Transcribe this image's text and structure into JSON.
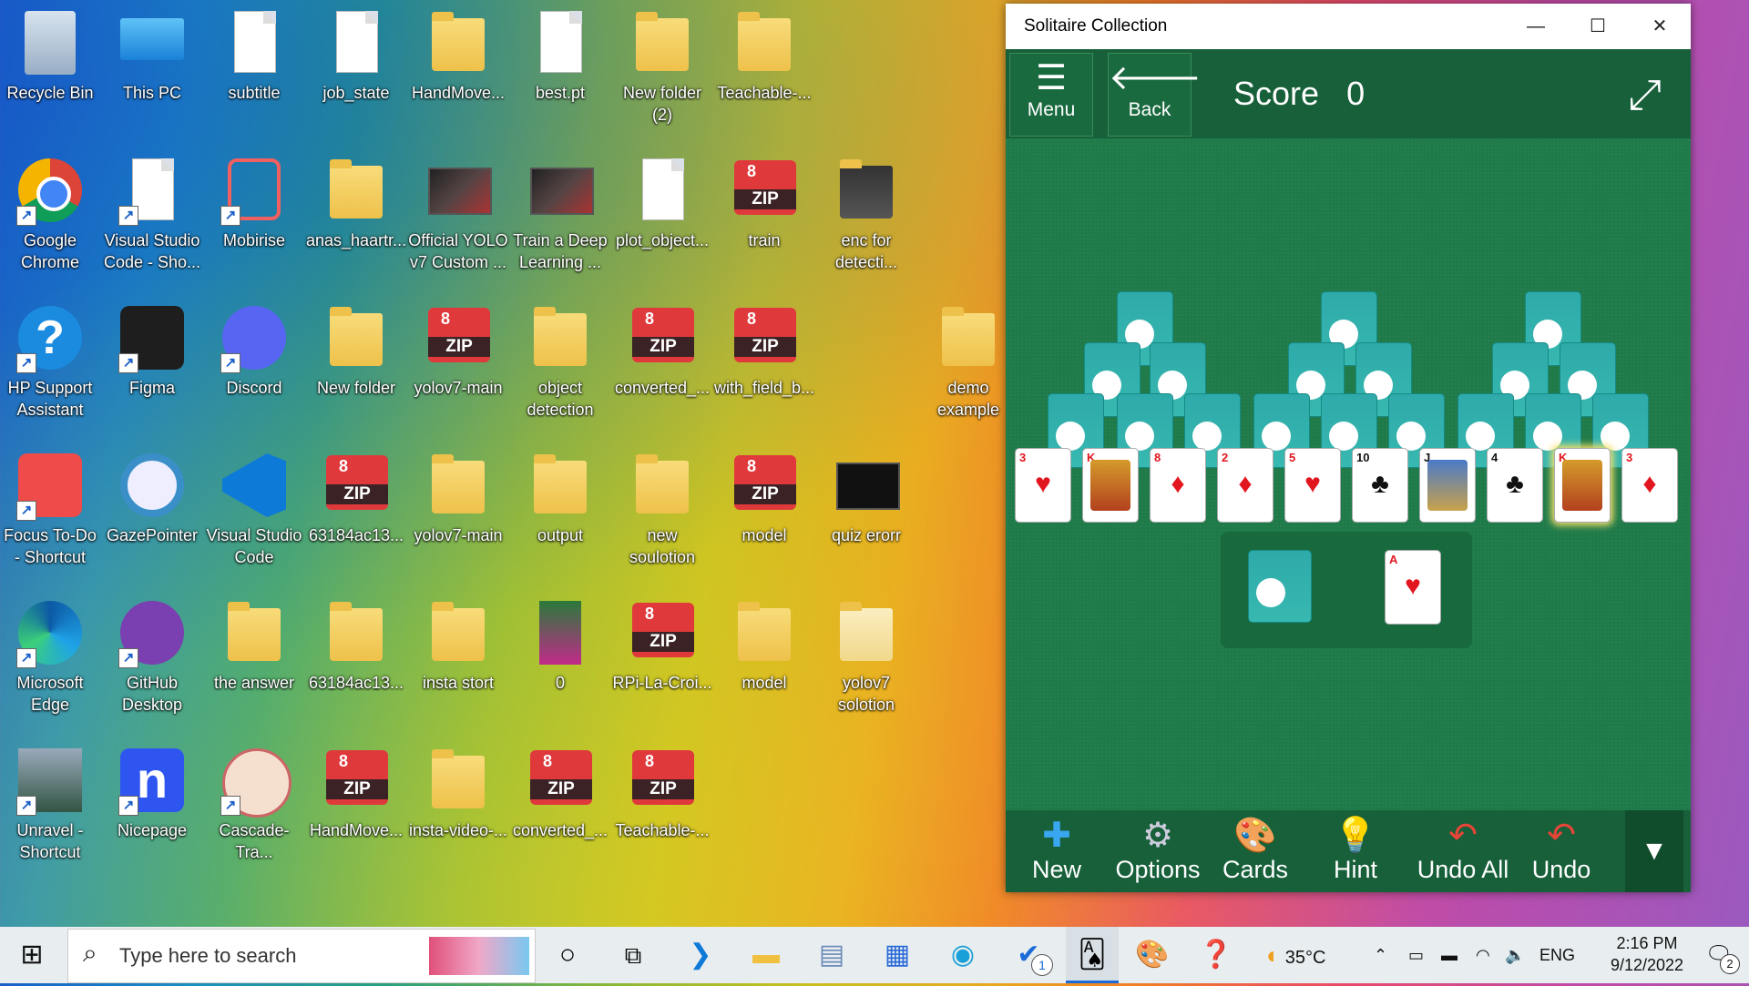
{
  "desktop_icons": [
    {
      "label": "Recycle Bin",
      "icon": "recycle-bin-icon"
    },
    {
      "label": "This PC",
      "icon": "computer-icon"
    },
    {
      "label": "subtitle",
      "icon": "python-file-icon"
    },
    {
      "label": "job_state",
      "icon": "file-icon"
    },
    {
      "label": "HandMove...",
      "icon": "folder-icon"
    },
    {
      "label": "best.pt",
      "icon": "file-icon"
    },
    {
      "label": "New folder (2)",
      "icon": "folder-icon"
    },
    {
      "label": "Teachable-...",
      "icon": "folder-icon"
    },
    {
      "label": "Google Chrome",
      "icon": "chrome-icon"
    },
    {
      "label": "Visual Studio Code - Sho...",
      "icon": "file-icon"
    },
    {
      "label": "Mobirise",
      "icon": "mobirise-icon"
    },
    {
      "label": "anas_haartr...",
      "icon": "folder-icon"
    },
    {
      "label": "Official YOLO v7 Custom ...",
      "icon": "video-icon"
    },
    {
      "label": "Train a Deep Learning ...",
      "icon": "video-icon"
    },
    {
      "label": "plot_object...",
      "icon": "python-file-icon"
    },
    {
      "label": "train",
      "icon": "zip-icon"
    },
    {
      "label": "enc for detecti...",
      "icon": "folder-icon"
    },
    {
      "label": "HP Support Assistant",
      "icon": "help-icon"
    },
    {
      "label": "Figma",
      "icon": "figma-icon"
    },
    {
      "label": "Discord",
      "icon": "discord-icon"
    },
    {
      "label": "New folder",
      "icon": "folder-icon"
    },
    {
      "label": "yolov7-main",
      "icon": "zip-icon"
    },
    {
      "label": "object detection",
      "icon": "folder-icon"
    },
    {
      "label": "converted_...",
      "icon": "zip-icon"
    },
    {
      "label": "with_field_b...",
      "icon": "zip-icon"
    },
    {
      "label": "demo example",
      "icon": "folder-icon"
    },
    {
      "label": "Focus To-Do - Shortcut",
      "icon": "focus-todo-icon"
    },
    {
      "label": "GazePointer",
      "icon": "gazepointer-icon"
    },
    {
      "label": "Visual Studio Code",
      "icon": "vscode-icon"
    },
    {
      "label": "63184ac13...",
      "icon": "zip-icon"
    },
    {
      "label": "yolov7-main",
      "icon": "folder-icon"
    },
    {
      "label": "output",
      "icon": "folder-icon"
    },
    {
      "label": "new soulotion",
      "icon": "folder-icon"
    },
    {
      "label": "model",
      "icon": "zip-icon"
    },
    {
      "label": "quiz erorr",
      "icon": "image-icon"
    },
    {
      "label": "Microsoft Edge",
      "icon": "edge-icon"
    },
    {
      "label": "GitHub Desktop",
      "icon": "github-icon"
    },
    {
      "label": "the answer",
      "icon": "folder-icon"
    },
    {
      "label": "63184ac13...",
      "icon": "folder-icon"
    },
    {
      "label": "insta stort",
      "icon": "folder-icon"
    },
    {
      "label": "0",
      "icon": "image-icon"
    },
    {
      "label": "RPi-La-Croi...",
      "icon": "zip-icon"
    },
    {
      "label": "model",
      "icon": "folder-icon"
    },
    {
      "label": "yolov7 solotion",
      "icon": "folder-icon"
    },
    {
      "label": "Unravel - Shortcut",
      "icon": "unravel-icon"
    },
    {
      "label": "Nicepage",
      "icon": "nicepage-icon"
    },
    {
      "label": "Cascade-Tra...",
      "icon": "cascade-icon"
    },
    {
      "label": "HandMove...",
      "icon": "zip-icon"
    },
    {
      "label": "insta-video-...",
      "icon": "folder-icon"
    },
    {
      "label": "converted_...",
      "icon": "zip-icon"
    },
    {
      "label": "Teachable-...",
      "icon": "zip-icon"
    }
  ],
  "solitaire": {
    "title": "Solitaire Collection",
    "menu_label": "Menu",
    "back_label": "Back",
    "score_label": "Score",
    "score_value": "0",
    "bottom_row_cards": [
      {
        "rank": "3",
        "suit": "♥",
        "color": "red"
      },
      {
        "rank": "K",
        "suit": "♦",
        "color": "red"
      },
      {
        "rank": "8",
        "suit": "♦",
        "color": "red"
      },
      {
        "rank": "2",
        "suit": "♦",
        "color": "red"
      },
      {
        "rank": "5",
        "suit": "♥",
        "color": "red"
      },
      {
        "rank": "10",
        "suit": "♣",
        "color": "blk"
      },
      {
        "rank": "J",
        "suit": "♠",
        "color": "blk"
      },
      {
        "rank": "4",
        "suit": "♣",
        "color": "blk"
      },
      {
        "rank": "K",
        "suit": "♣",
        "color": "blk"
      },
      {
        "rank": "3",
        "suit": "♦",
        "color": "red"
      }
    ],
    "waste_card": {
      "rank": "A",
      "suit": "♥"
    },
    "bottom_buttons": [
      "New",
      "Options",
      "Cards",
      "Hint",
      "Undo All",
      "Undo"
    ]
  },
  "taskbar": {
    "search_placeholder": "Type here to search",
    "weather": "35°C",
    "language": "ENG",
    "time": "2:16 PM",
    "date": "9/12/2022",
    "notification_count": "2",
    "badge_count": "1"
  }
}
